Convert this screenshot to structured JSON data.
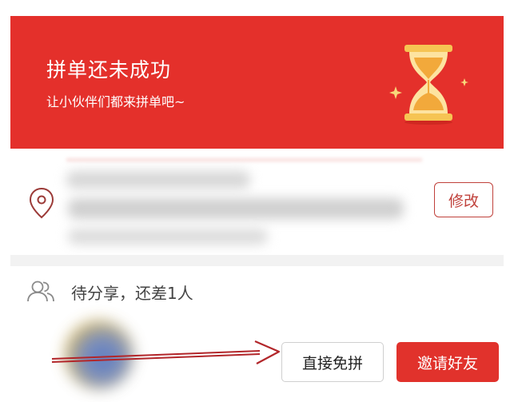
{
  "banner": {
    "title": "拼单还未成功",
    "subtitle": "让小伙伴们都来拼单吧~"
  },
  "address": {
    "icon": "location-pin-icon",
    "edit_label": "修改"
  },
  "group": {
    "icon": "people-icon",
    "status_text": "待分享，还差1人",
    "direct_label": "直接免拼",
    "invite_label": "邀请好友"
  },
  "colors": {
    "banner_red": "#e4302b",
    "accent_red": "#c0413b",
    "invite_red": "#e1322c",
    "hourglass_gold": "#f4c24e"
  }
}
